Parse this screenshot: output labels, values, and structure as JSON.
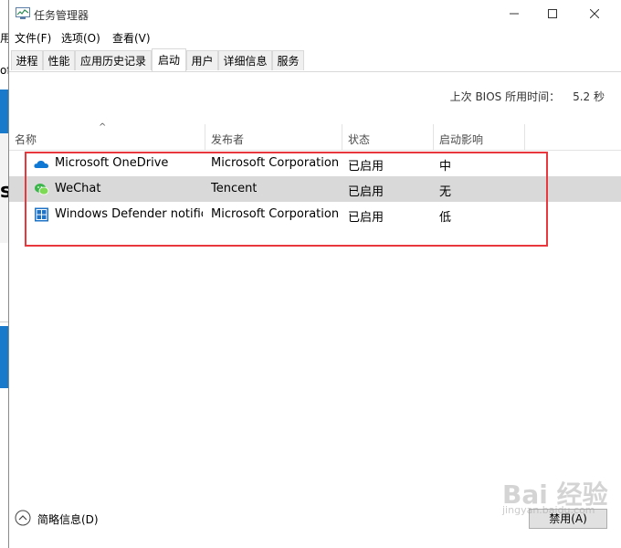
{
  "background": {
    "fragment_1": "用",
    "fragment_2": "oft",
    "fragment_3": "s"
  },
  "window": {
    "title": "任务管理器",
    "title_icon": "task-manager-icon"
  },
  "menu": [
    "文件(F)",
    "选项(O)",
    "查看(V)"
  ],
  "tabs": [
    "进程",
    "性能",
    "应用历史记录",
    "启动",
    "用户",
    "详细信息",
    "服务"
  ],
  "active_tab": "启动",
  "bios": {
    "label": "上次 BIOS 所用时间：",
    "value": "5.2 秒"
  },
  "columns": [
    "名称",
    "发布者",
    "状态",
    "启动影响"
  ],
  "rows": [
    {
      "icon": "onedrive-icon",
      "name": "Microsoft OneDrive",
      "publisher": "Microsoft Corporation",
      "status": "已启用",
      "impact": "中"
    },
    {
      "icon": "wechat-icon",
      "name": "WeChat",
      "publisher": "Tencent",
      "status": "已启用",
      "impact": "无"
    },
    {
      "icon": "windows-defender-icon",
      "name": "Windows Defender notific...",
      "publisher": "Microsoft Corporation",
      "status": "已启用",
      "impact": "低"
    }
  ],
  "selected_row": 1,
  "footer": {
    "details_label": "简略信息(D)",
    "disable_button": "禁用(A)"
  },
  "watermark": {
    "main": "Bai 经验",
    "sub": "jingyan.baidu.com"
  },
  "colors": {
    "highlight_box": "#e8383d",
    "selected_row": "#d9d9d9",
    "onedrive": "#0f78d4",
    "wechat": "#39b54a",
    "defender": "#1f73c6"
  }
}
